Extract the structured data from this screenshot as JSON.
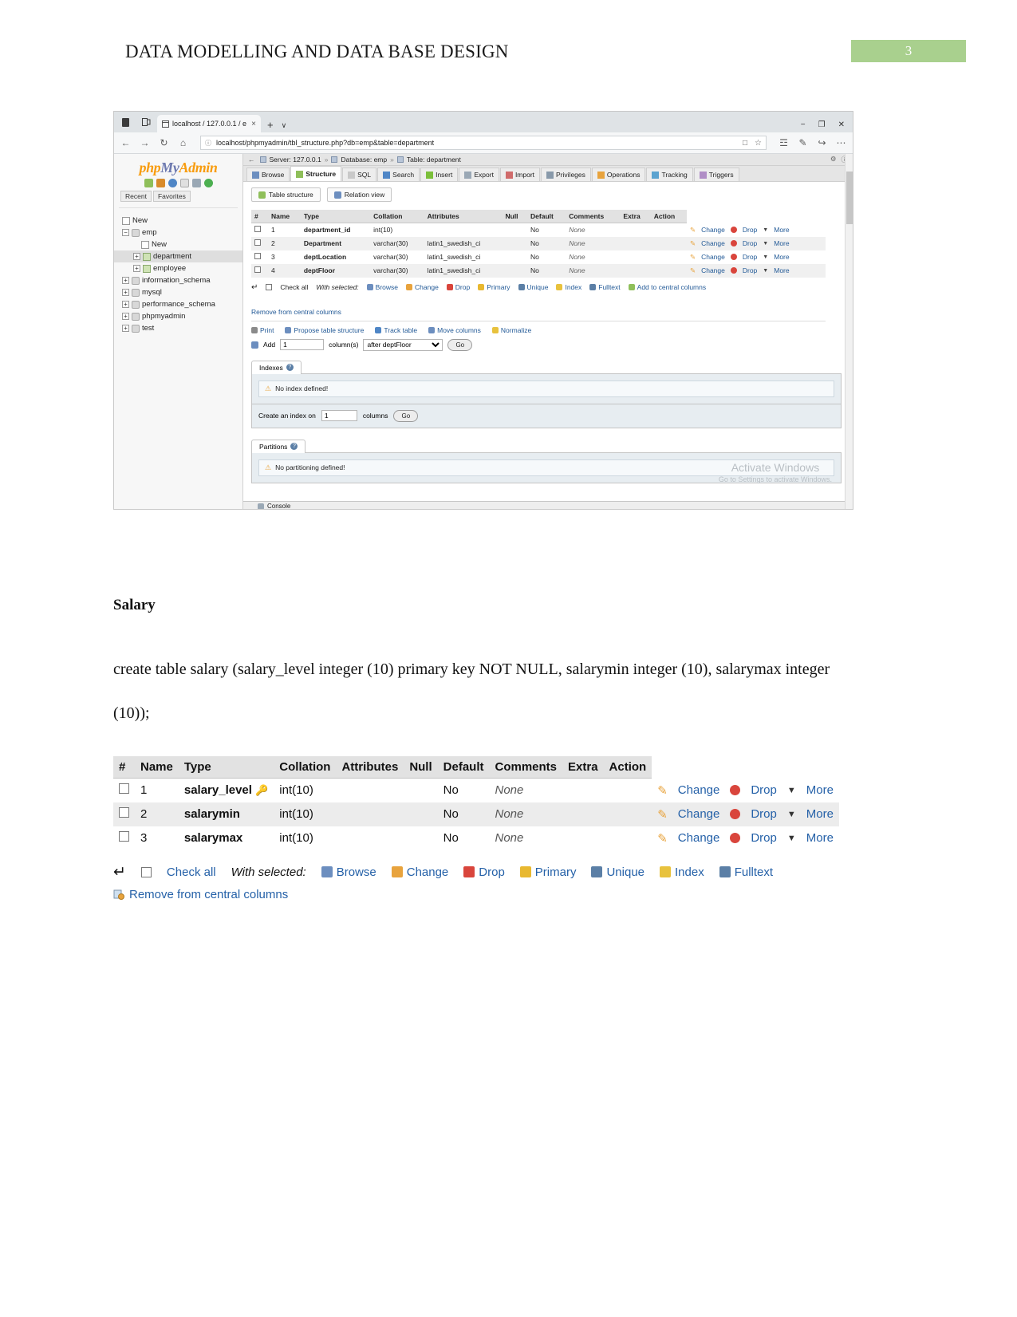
{
  "document": {
    "header_title": "DATA MODELLING AND DATA BASE DESIGN",
    "page_number": "3",
    "page_number_bg": "#a9d08e",
    "section_heading": "Salary",
    "paragraph": "create table salary (salary_level integer (10) primary key NOT NULL, salarymin integer (10), salarymax integer (10));"
  },
  "browser": {
    "tab_title": "localhost / 127.0.0.1 / e",
    "tab_close": "×",
    "new_tab": "+",
    "tab_chevron": "∨",
    "url": "localhost/phpmyadmin/tbl_structure.php?db=emp&table=department",
    "window_minimize": "−",
    "window_maximize": "❐",
    "window_close": "✕",
    "nav_back": "←",
    "nav_forward": "→",
    "nav_reload": "↻",
    "nav_home": "⌂",
    "url_info": "ⓘ",
    "url_reading": "□",
    "url_star": "☆",
    "tool_notes": "☲",
    "tool_pen": "✎",
    "tool_share": "↪",
    "tool_more": "⋯"
  },
  "phpmyadmin": {
    "logo_php": "php",
    "logo_my": "My",
    "logo_admin": "Admin",
    "quick_icons": [
      "home-icon",
      "sql-icon",
      "globe-icon",
      "docs-icon",
      "settings-icon",
      "refresh-icon"
    ],
    "recent_label": "Recent",
    "favorites_label": "Favorites",
    "tree": [
      {
        "label": "New",
        "level": 0,
        "kind": "new",
        "selected": false,
        "expander": ""
      },
      {
        "label": "emp",
        "level": 0,
        "kind": "db",
        "selected": false,
        "expander": "−"
      },
      {
        "label": "New",
        "level": 2,
        "kind": "new",
        "selected": false,
        "expander": ""
      },
      {
        "label": "department",
        "level": 1,
        "kind": "table",
        "selected": true,
        "expander": "+"
      },
      {
        "label": "employee",
        "level": 1,
        "kind": "table",
        "selected": false,
        "expander": "+"
      },
      {
        "label": "information_schema",
        "level": 0,
        "kind": "db",
        "selected": false,
        "expander": "+"
      },
      {
        "label": "mysql",
        "level": 0,
        "kind": "db",
        "selected": false,
        "expander": "+"
      },
      {
        "label": "performance_schema",
        "level": 0,
        "kind": "db",
        "selected": false,
        "expander": "+"
      },
      {
        "label": "phpmyadmin",
        "level": 0,
        "kind": "db",
        "selected": false,
        "expander": "+"
      },
      {
        "label": "test",
        "level": 0,
        "kind": "db",
        "selected": false,
        "expander": "+"
      }
    ],
    "breadcrumb": {
      "back_arrow": "←",
      "server": "Server: 127.0.0.1",
      "database": "Database: emp",
      "table": "Table: department",
      "sep": "»",
      "right_icons": [
        "settings-icon",
        "help-icon"
      ]
    },
    "tabs": [
      {
        "label": "Browse",
        "active": false,
        "icon": "browse-icon"
      },
      {
        "label": "Structure",
        "active": true,
        "icon": "structure-icon"
      },
      {
        "label": "SQL",
        "active": false,
        "icon": "sql-icon"
      },
      {
        "label": "Search",
        "active": false,
        "icon": "search-icon"
      },
      {
        "label": "Insert",
        "active": false,
        "icon": "insert-icon"
      },
      {
        "label": "Export",
        "active": false,
        "icon": "export-icon"
      },
      {
        "label": "Import",
        "active": false,
        "icon": "import-icon"
      },
      {
        "label": "Privileges",
        "active": false,
        "icon": "privileges-icon"
      },
      {
        "label": "Operations",
        "active": false,
        "icon": "operations-icon"
      },
      {
        "label": "Tracking",
        "active": false,
        "icon": "tracking-icon"
      },
      {
        "label": "Triggers",
        "active": false,
        "icon": "triggers-icon"
      }
    ],
    "subtabs": [
      {
        "label": "Table structure",
        "icon": "table-structure-icon"
      },
      {
        "label": "Relation view",
        "icon": "relation-view-icon"
      }
    ],
    "structure_table": {
      "headers": [
        "#",
        "Name",
        "Type",
        "Collation",
        "Attributes",
        "Null",
        "Default",
        "Comments",
        "Extra",
        "Action"
      ],
      "rows": [
        {
          "num": "1",
          "name": "department_id",
          "type": "int(10)",
          "collation": "",
          "attributes": "",
          "null": "No",
          "default": "None",
          "comments": "",
          "extra": "",
          "actions": [
            "Change",
            "Drop",
            "More"
          ]
        },
        {
          "num": "2",
          "name": "Department",
          "type": "varchar(30)",
          "collation": "latin1_swedish_ci",
          "attributes": "",
          "null": "No",
          "default": "None",
          "comments": "",
          "extra": "",
          "actions": [
            "Change",
            "Drop",
            "More"
          ]
        },
        {
          "num": "3",
          "name": "deptLocation",
          "type": "varchar(30)",
          "collation": "latin1_swedish_ci",
          "attributes": "",
          "null": "No",
          "default": "None",
          "comments": "",
          "extra": "",
          "actions": [
            "Change",
            "Drop",
            "More"
          ]
        },
        {
          "num": "4",
          "name": "deptFloor",
          "type": "varchar(30)",
          "collation": "latin1_swedish_ci",
          "attributes": "",
          "null": "No",
          "default": "None",
          "comments": "",
          "extra": "",
          "actions": [
            "Change",
            "Drop",
            "More"
          ]
        }
      ]
    },
    "with_selected": {
      "check_all": "Check all",
      "label": "With selected:",
      "links": [
        "Browse",
        "Change",
        "Drop",
        "Primary",
        "Unique",
        "Index",
        "Fulltext",
        "Add to central columns"
      ],
      "remove_central": "Remove from central columns"
    },
    "operations_row": [
      "Print",
      "Propose table structure",
      "Track table",
      "Move columns",
      "Normalize"
    ],
    "add_row": {
      "add_label": "Add",
      "count": "1",
      "columns_label": "column(s)",
      "position": "after deptFloor",
      "go": "Go"
    },
    "indexes_panel": {
      "title": "Indexes",
      "message": "No index defined!",
      "create_label": "Create an index on",
      "create_count": "1",
      "columns_label": "columns",
      "go": "Go"
    },
    "partitions_panel": {
      "title": "Partitions",
      "message": "No partitioning defined!"
    },
    "console_label": "Console",
    "watermark": {
      "line1": "Activate Windows",
      "line2": "Go to Settings to activate Windows."
    }
  },
  "salary_table": {
    "headers": [
      "#",
      "Name",
      "Type",
      "Collation",
      "Attributes",
      "Null",
      "Default",
      "Comments",
      "Extra",
      "Action"
    ],
    "rows": [
      {
        "num": "1",
        "name": "salary_level",
        "primary": true,
        "type": "int(10)",
        "collation": "",
        "attributes": "",
        "null": "No",
        "default": "None",
        "comments": "",
        "extra": "",
        "actions": [
          "Change",
          "Drop",
          "More"
        ]
      },
      {
        "num": "2",
        "name": "salarymin",
        "primary": false,
        "type": "int(10)",
        "collation": "",
        "attributes": "",
        "null": "No",
        "default": "None",
        "comments": "",
        "extra": "",
        "actions": [
          "Change",
          "Drop",
          "More"
        ]
      },
      {
        "num": "3",
        "name": "salarymax",
        "primary": false,
        "type": "int(10)",
        "collation": "",
        "attributes": "",
        "null": "No",
        "default": "None",
        "comments": "",
        "extra": "",
        "actions": [
          "Change",
          "Drop",
          "More"
        ]
      }
    ],
    "footer": {
      "check_all": "Check all",
      "with_selected": "With selected:",
      "links": [
        "Browse",
        "Change",
        "Drop",
        "Primary",
        "Unique",
        "Index",
        "Fulltext"
      ],
      "remove_central": "Remove from central columns"
    }
  },
  "colors": {
    "link": "#2561a8",
    "header_bg": "#e2e2e2",
    "alt_row": "#ececec",
    "accent_green": "#a9d08e",
    "drop_red": "#d9453c",
    "pencil_orange": "#e8a33d"
  }
}
